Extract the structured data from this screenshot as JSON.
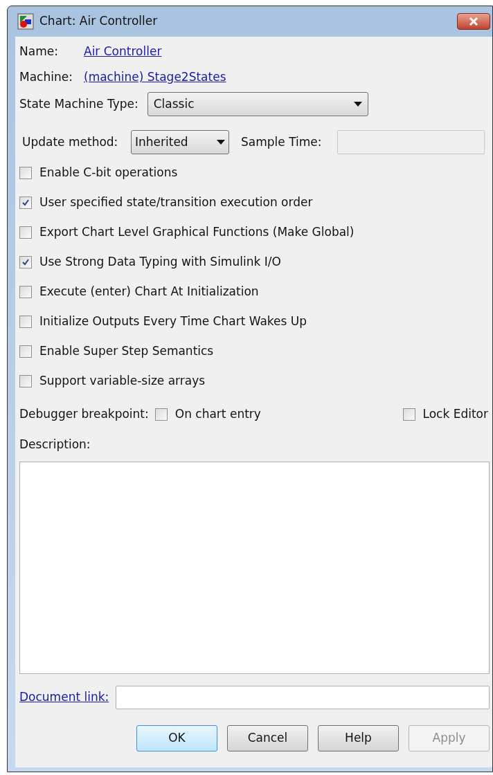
{
  "window": {
    "title": "Chart: Air Controller"
  },
  "name": {
    "label": "Name:",
    "value": "Air Controller"
  },
  "machine": {
    "label": "Machine:",
    "value": "(machine) Stage2States"
  },
  "state_machine_type": {
    "label": "State Machine Type:",
    "value": "Classic"
  },
  "update_method": {
    "label": "Update method:",
    "value": "Inherited"
  },
  "sample_time": {
    "label": "Sample Time:",
    "disabled": true
  },
  "options": [
    {
      "label": "Enable C-bit operations",
      "checked": false
    },
    {
      "label": "User specified state/transition execution order",
      "checked": true
    },
    {
      "label": "Export Chart Level Graphical Functions (Make Global)",
      "checked": false
    },
    {
      "label": "Use Strong Data Typing with Simulink I/O",
      "checked": true
    },
    {
      "label": "Execute (enter) Chart At Initialization",
      "checked": false
    },
    {
      "label": "Initialize Outputs Every Time Chart Wakes Up",
      "checked": false
    },
    {
      "label": "Enable Super Step Semantics",
      "checked": false
    },
    {
      "label": "Support variable-size arrays",
      "checked": false
    }
  ],
  "debugger_breakpoint": {
    "label": "Debugger breakpoint:",
    "option": {
      "label": "On chart entry",
      "checked": false
    }
  },
  "lock_editor": {
    "label": "Lock Editor",
    "checked": false
  },
  "description": {
    "label": "Description:"
  },
  "document_link": {
    "label": "Document link:"
  },
  "buttons": [
    {
      "label": "OK",
      "default": true,
      "disabled": false
    },
    {
      "label": "Cancel",
      "default": false,
      "disabled": false
    },
    {
      "label": "Help",
      "default": false,
      "disabled": false
    },
    {
      "label": "Apply",
      "default": false,
      "disabled": true
    }
  ]
}
